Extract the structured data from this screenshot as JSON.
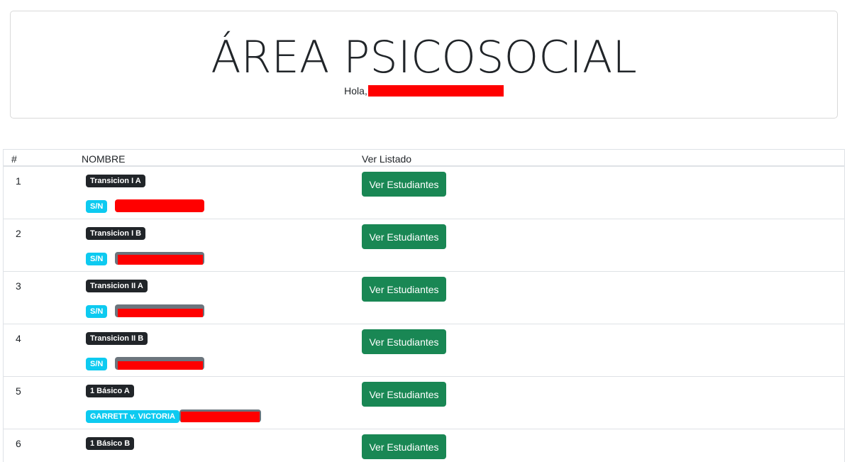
{
  "header": {
    "title": "ÁREA PSICOSOCIAL",
    "greeting": "Hola,"
  },
  "table": {
    "columns": [
      "#",
      "NOMBRE",
      "Ver Listado"
    ],
    "button_label": "Ver Estudiantes",
    "rows": [
      {
        "num": "1",
        "course": "Transicion I A",
        "teacher_tag": "S/N"
      },
      {
        "num": "2",
        "course": "Transicion I B",
        "teacher_tag": "S/N"
      },
      {
        "num": "3",
        "course": "Transicion II A",
        "teacher_tag": "S/N"
      },
      {
        "num": "4",
        "course": "Transicion II B",
        "teacher_tag": "S/N"
      },
      {
        "num": "5",
        "course": "1 Básico A",
        "teacher_tag": "GARRETT v. VICTORIA"
      },
      {
        "num": "6",
        "course": "1 Básico B",
        "teacher_tag": ""
      }
    ]
  },
  "colors": {
    "success": "#198754",
    "info": "#0dcaf0",
    "dark": "#212529",
    "redaction": "#ff0000"
  }
}
